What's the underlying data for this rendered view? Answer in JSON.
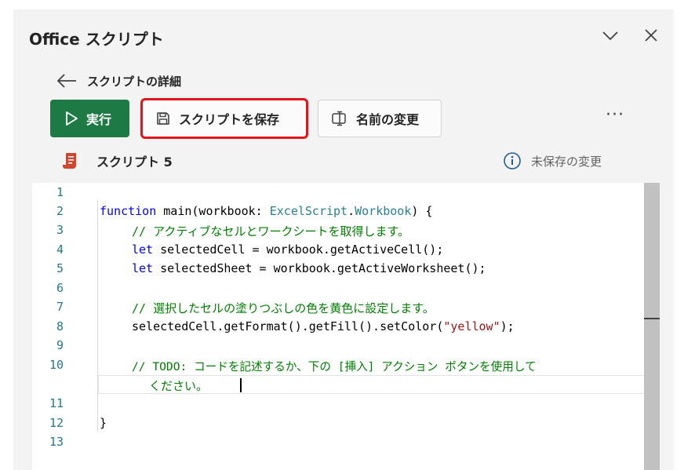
{
  "header": {
    "title": "Office スクリプト"
  },
  "nav": {
    "back_label": "スクリプトの詳細"
  },
  "toolbar": {
    "run_label": "実行",
    "save_label": "スクリプトを保存",
    "rename_label": "名前の変更",
    "more_label": "···"
  },
  "script": {
    "name": "スクリプト 5",
    "status": "未保存の変更"
  },
  "editor": {
    "line_numbers": [
      "1",
      "2",
      "3",
      "4",
      "5",
      "6",
      "7",
      "8",
      "9",
      "10",
      "11",
      "12",
      "13"
    ],
    "code": {
      "l2_kw": "function",
      "l2_a": " main(workbook: ",
      "l2_ty1": "ExcelScript",
      "l2_dot": ".",
      "l2_ty2": "Workbook",
      "l2_b": ") {",
      "l3": "// アクティブなセルとワークシートを取得します。",
      "l4_kw": "let",
      "l4_rest": " selectedCell = workbook.getActiveCell();",
      "l5_kw": "let",
      "l5_rest": " selectedSheet = workbook.getActiveWorksheet();",
      "l7": "// 選択したセルの塗りつぶしの色を黄色に設定します。",
      "l8_a": "selectedCell.getFormat().getFill().setColor(",
      "l8_str": "\"yellow\"",
      "l8_b": ");",
      "l10": "// TODO: コードを記述するか、下の [挿入] アクション ボタンを使用して",
      "l10_wrap": "ください。",
      "l12": "}"
    }
  },
  "colors": {
    "run_button": "#1e7a44",
    "highlight_box": "#e6141a",
    "keyword": "#0000ff",
    "type": "#267f99",
    "comment": "#008000",
    "string": "#a31515",
    "line_number": "#237893"
  }
}
